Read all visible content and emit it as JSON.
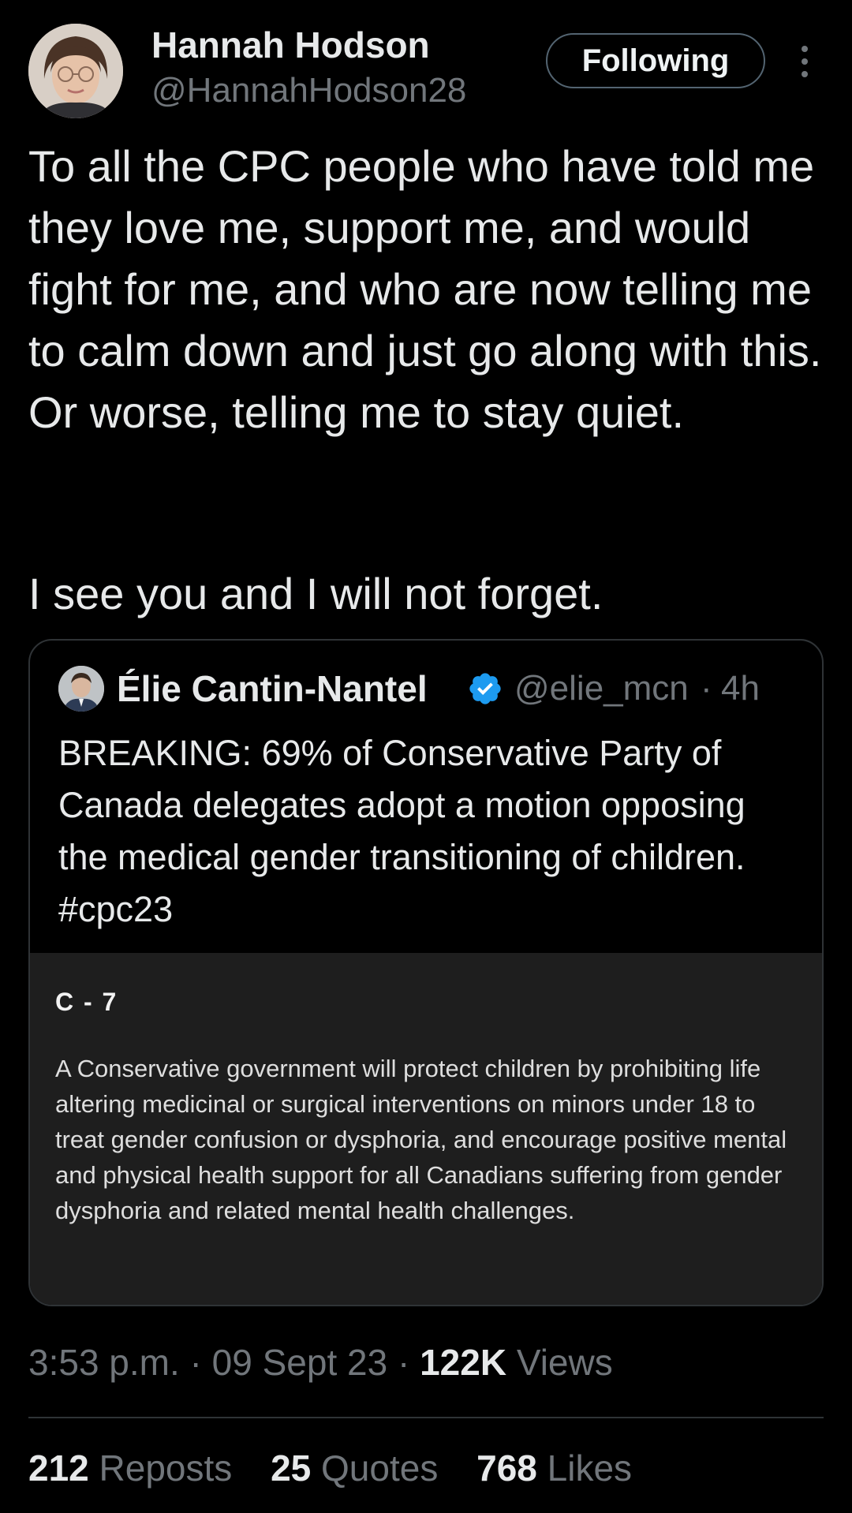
{
  "author": {
    "name": "Hannah Hodson",
    "handle": "@HannahHodson28",
    "avatar_icon": "profile-photo"
  },
  "follow_button": {
    "label": "Following"
  },
  "more_menu": {
    "icon": "vertical-ellipsis-icon"
  },
  "tweet": {
    "paragraph_1": "To all the CPC people who have told me they love me, support me, and would fight for me, and who are now telling me to calm down and just go along with this. Or worse, telling me to stay quiet.",
    "paragraph_2": "I see you and I will not forget."
  },
  "quoted_tweet": {
    "author_name": "Élie Cantin-Nantel",
    "verified_icon": "verified-badge-icon",
    "verified_color": "#1d9bf0",
    "handle": "@elie_mcn",
    "separator": "·",
    "time": "4h",
    "text": "BREAKING: 69% of Conservative Party of Canada delegates adopt a motion opposing the medical gender transitioning of children. #cpc23",
    "media": {
      "title": "C - 7",
      "body": "A Conservative government will protect children by prohibiting life altering medicinal or surgical interventions on minors under 18 to treat gender confusion or dysphoria, and encourage positive mental and physical health support for all Canadians suffering from gender dysphoria and related mental health challenges."
    }
  },
  "meta": {
    "time": "3:53 p.m.",
    "sep1": " · ",
    "date": "09 Sept 23",
    "sep2": " · ",
    "views_count": "122K",
    "views_label": " Views"
  },
  "stats": {
    "reposts_count": "212",
    "reposts_label": " Reposts",
    "quotes_count": "25",
    "quotes_label": " Quotes",
    "likes_count": "768",
    "likes_label": " Likes"
  },
  "colors": {
    "background": "#000000",
    "text_primary": "#e7e9ea",
    "text_secondary": "#71767b",
    "border": "#2f3336",
    "media_background": "#1e1e1e"
  }
}
